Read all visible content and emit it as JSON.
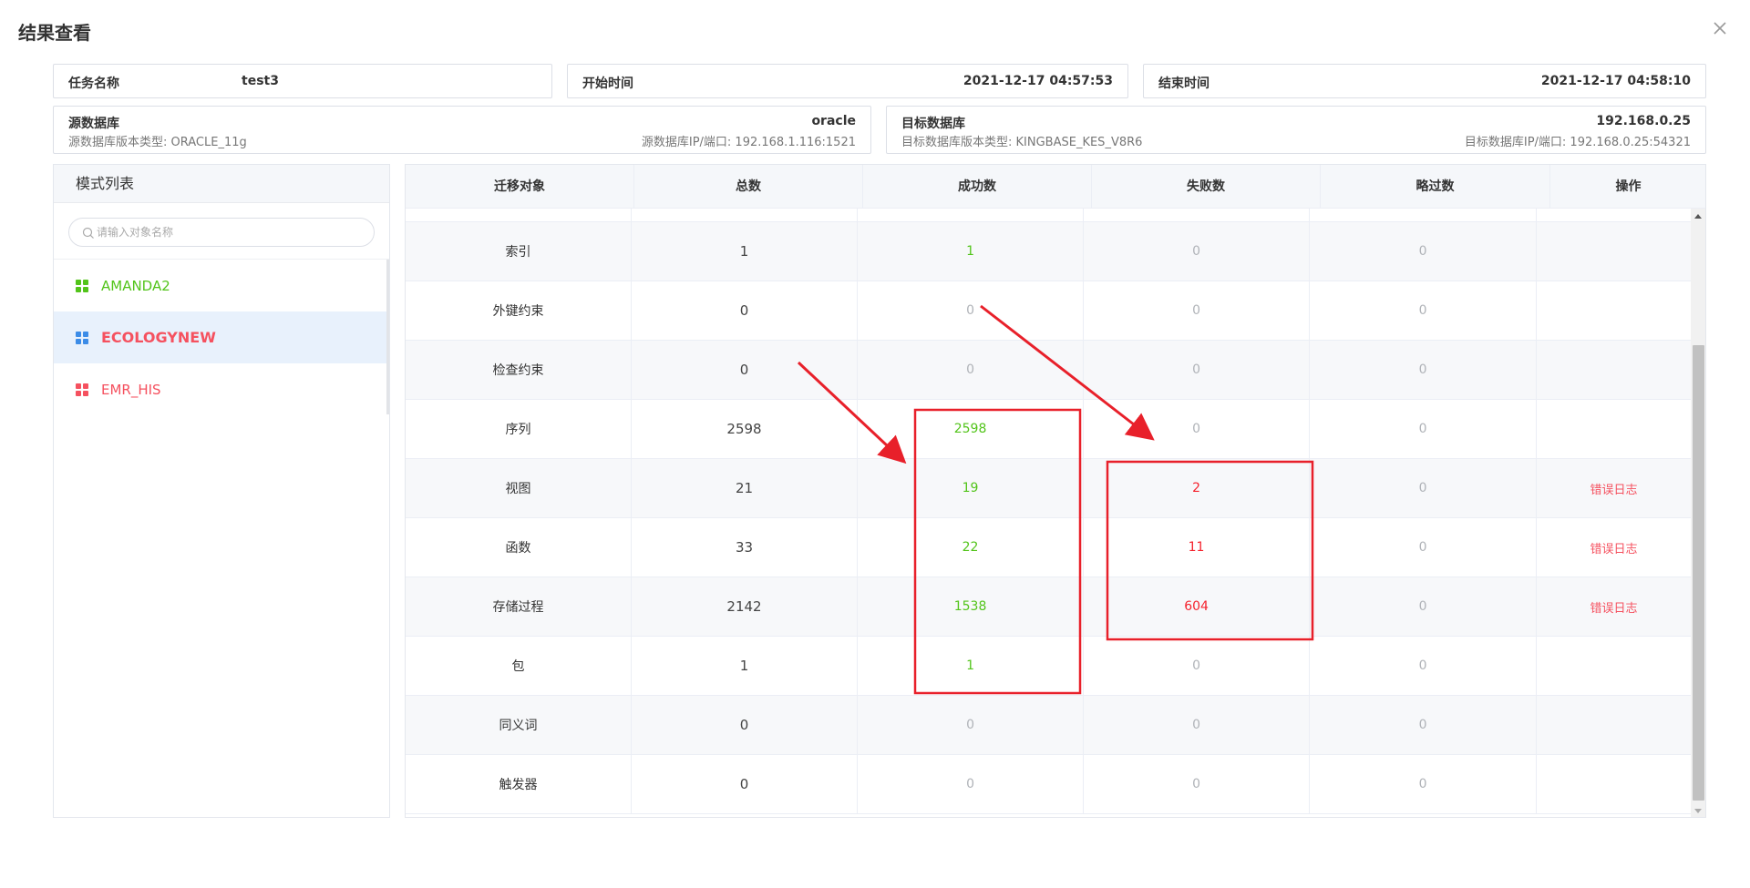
{
  "dialog": {
    "title": "结果查看"
  },
  "task": {
    "name_label": "任务名称",
    "name_value": "test3",
    "start_label": "开始时间",
    "start_value": "2021-12-17 04:57:53",
    "end_label": "结束时间",
    "end_value": "2021-12-17 04:58:10"
  },
  "source_db": {
    "label": "源数据库",
    "value": "oracle",
    "version_text": "源数据库版本类型:  ORACLE_11g",
    "ip_text": "源数据库IP/端口:  192.168.1.116:1521"
  },
  "target_db": {
    "label": "目标数据库",
    "value": "192.168.0.25",
    "version_text": "目标数据库版本类型:  KINGBASE_KES_V8R6",
    "ip_text": "目标数据库IP/端口:  192.168.0.25:54321"
  },
  "schema_panel": {
    "title": "模式列表",
    "search_placeholder": "请输入对象名称",
    "items": [
      {
        "label": "AMANDA2",
        "status": "success"
      },
      {
        "label": "ECOLOGYNEW",
        "status": "error",
        "active": true
      },
      {
        "label": "EMR_HIS",
        "status": "error"
      }
    ]
  },
  "table": {
    "headers": [
      "迁移对象",
      "总数",
      "成功数",
      "失败数",
      "略过数",
      "操作"
    ],
    "rows": [
      {
        "name": "索引",
        "total": "1",
        "success": "1",
        "fail": "0",
        "skip": "0",
        "op": ""
      },
      {
        "name": "外键约束",
        "total": "0",
        "success": "0",
        "fail": "0",
        "skip": "0",
        "op": ""
      },
      {
        "name": "检查约束",
        "total": "0",
        "success": "0",
        "fail": "0",
        "skip": "0",
        "op": ""
      },
      {
        "name": "序列",
        "total": "2598",
        "success": "2598",
        "fail": "0",
        "skip": "0",
        "op": ""
      },
      {
        "name": "视图",
        "total": "21",
        "success": "19",
        "fail": "2",
        "skip": "0",
        "op": "错误日志"
      },
      {
        "name": "函数",
        "total": "33",
        "success": "22",
        "fail": "11",
        "skip": "0",
        "op": "错误日志"
      },
      {
        "name": "存储过程",
        "total": "2142",
        "success": "1538",
        "fail": "604",
        "skip": "0",
        "op": "错误日志"
      },
      {
        "name": "包",
        "total": "1",
        "success": "1",
        "fail": "0",
        "skip": "0",
        "op": ""
      },
      {
        "name": "同义词",
        "total": "0",
        "success": "0",
        "fail": "0",
        "skip": "0",
        "op": ""
      },
      {
        "name": "触发器",
        "total": "0",
        "success": "0",
        "fail": "0",
        "skip": "0",
        "op": ""
      }
    ]
  },
  "colors": {
    "success": "#52c41a",
    "fail": "#f5222d",
    "error_schema": "#f5515f",
    "active_bg": "#e8f1fc",
    "annotation": "#e8202a"
  },
  "icons": {
    "close": "close-icon",
    "search": "search-icon",
    "schema": "grid-icon"
  }
}
